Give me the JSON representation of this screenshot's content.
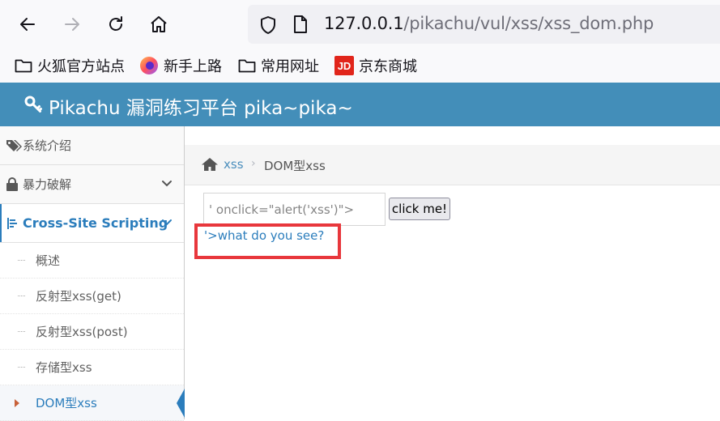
{
  "browser": {
    "url_host": "127.0.0.1",
    "url_path": "/pikachu/vul/xss/xss_dom.php"
  },
  "bookmarks": [
    {
      "label": "火狐官方站点",
      "icon": "folder-icon"
    },
    {
      "label": "新手上路",
      "icon": "firefox-icon"
    },
    {
      "label": "常用网址",
      "icon": "folder-icon"
    },
    {
      "label": "京东商城",
      "icon": "jd-icon"
    }
  ],
  "header": {
    "title": "Pikachu 漏洞练习平台 pika~pika~"
  },
  "sidebar": {
    "items": [
      {
        "label": "系统介绍",
        "icon": "tags-icon"
      },
      {
        "label": "暴力破解",
        "icon": "lock-icon"
      },
      {
        "label": "Cross-Site Scripting",
        "icon": "list-icon"
      }
    ],
    "sub_items": [
      {
        "label": "概述"
      },
      {
        "label": "反射型xss(get)"
      },
      {
        "label": "反射型xss(post)"
      },
      {
        "label": "存储型xss"
      },
      {
        "label": "DOM型xss"
      }
    ]
  },
  "breadcrumb": {
    "link": "xss",
    "current": "DOM型xss"
  },
  "form": {
    "input_value": "' onclick=\"alert('xss')\">",
    "button_label": "click me!",
    "link_text": "'>what do you see?"
  },
  "colors": {
    "header_bg": "#438eb9",
    "accent": "#2b7dbc",
    "highlight_border": "#e8373c"
  }
}
